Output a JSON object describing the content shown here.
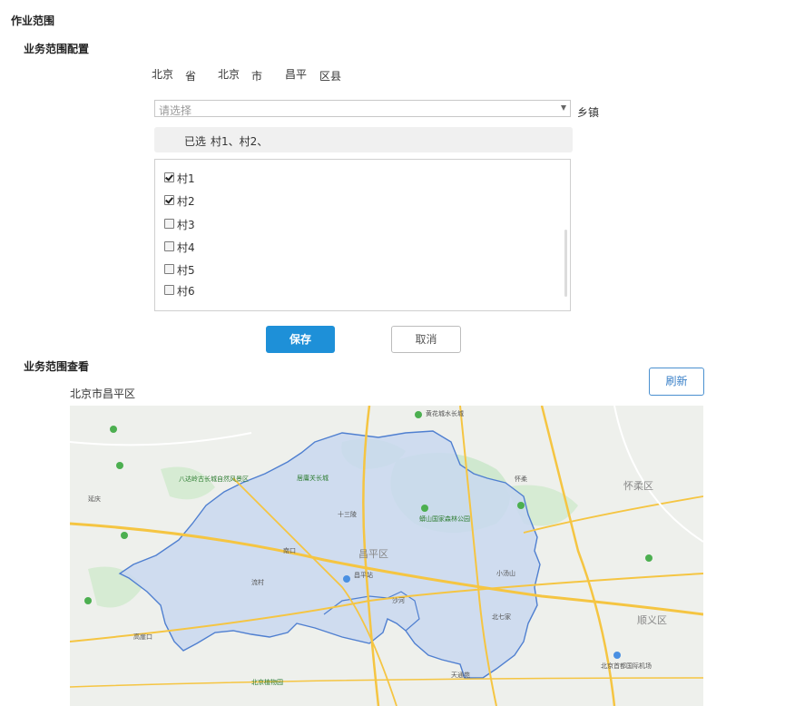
{
  "section": {
    "title": "作业范围"
  },
  "config": {
    "title": "业务范围配置",
    "province": "北京",
    "province_unit": "省",
    "city": "北京",
    "city_unit": "市",
    "district": "昌平",
    "district_unit": "区县",
    "township_select": {
      "placeholder": "请选择",
      "unit": "乡镇"
    },
    "selected": {
      "label": "已选",
      "value": "村1、村2、"
    },
    "villages": [
      {
        "label": "村1",
        "checked": true
      },
      {
        "label": "村2",
        "checked": true
      },
      {
        "label": "村3",
        "checked": false
      },
      {
        "label": "村4",
        "checked": false
      },
      {
        "label": "村5",
        "checked": false
      },
      {
        "label": "村6",
        "checked": false
      }
    ],
    "save_label": "保存",
    "cancel_label": "取消"
  },
  "view": {
    "title": "业务范围查看",
    "region": "北京市昌平区",
    "refresh_label": "刷新"
  },
  "map": {
    "labels": {
      "huanghuacheng": "黄花城水长城",
      "changping_district": "昌平区",
      "huairou_district": "怀柔区",
      "shunyi_district": "顺义区",
      "changping_station": "昌平站",
      "mangshan": "蟒山国家森林公园",
      "juyongguan": "居庸关长城",
      "capital_airport": "北京首都国际机场",
      "badaling": "八达岭古长城自然风景区",
      "beijing_botanic": "北京植物园",
      "tiantongyuan": "天通苑",
      "shahe": "沙河",
      "xiaotangshan": "小汤山",
      "beiqijia": "北七家",
      "nankou": "南口",
      "liucun": "流村",
      "gaoyakou": "高崖口",
      "shisanling": "十三陵",
      "yanqing": "延庆",
      "huairou_city": "怀柔"
    },
    "colors": {
      "region_fill": "#c9d8f0",
      "region_border": "#4f7fd0",
      "park_green": "#c8e6c9",
      "highway": "#f5c542",
      "road": "#ffffff"
    }
  }
}
